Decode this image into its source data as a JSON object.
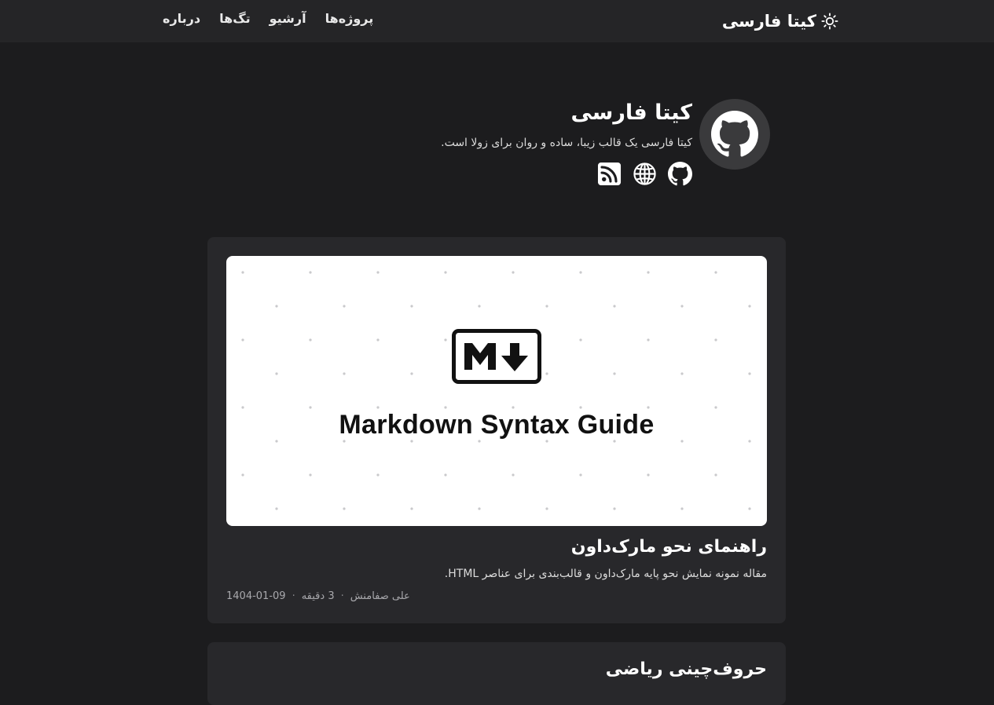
{
  "header": {
    "brand_title": "کیتا فارسی",
    "theme_icon": "sun-icon",
    "nav": [
      {
        "label": "پروژه‌ها"
      },
      {
        "label": "آرشیو"
      },
      {
        "label": "تگ‌ها"
      },
      {
        "label": "درباره"
      }
    ]
  },
  "profile": {
    "avatar_icon": "github-icon",
    "name": "کیتا فارسی",
    "bio": "کیتا فارسی یک قالب زیبا، ساده و روان برای زولا است.",
    "socials": [
      {
        "icon": "github-icon"
      },
      {
        "icon": "globe-icon"
      },
      {
        "icon": "rss-icon"
      }
    ]
  },
  "posts": [
    {
      "cover_caption": "Markdown Syntax Guide",
      "cover_icon": "markdown-icon",
      "title": "راهنمای نحو مارک‌داون",
      "summary": "مقاله نمونه نمایش نحو پایه مارک‌داون و قالب‌بندی برای عناصر HTML.",
      "author": "علی صفامنش",
      "reading_time": "3 دقیقه",
      "date": "1404-01-09"
    },
    {
      "title": "حروف‌چینی ریاضی"
    }
  ],
  "colors": {
    "background": "#1c1c1e",
    "header": "#252527",
    "card": "#28282b",
    "text": "#ffffff",
    "muted": "#a9a9ad"
  }
}
